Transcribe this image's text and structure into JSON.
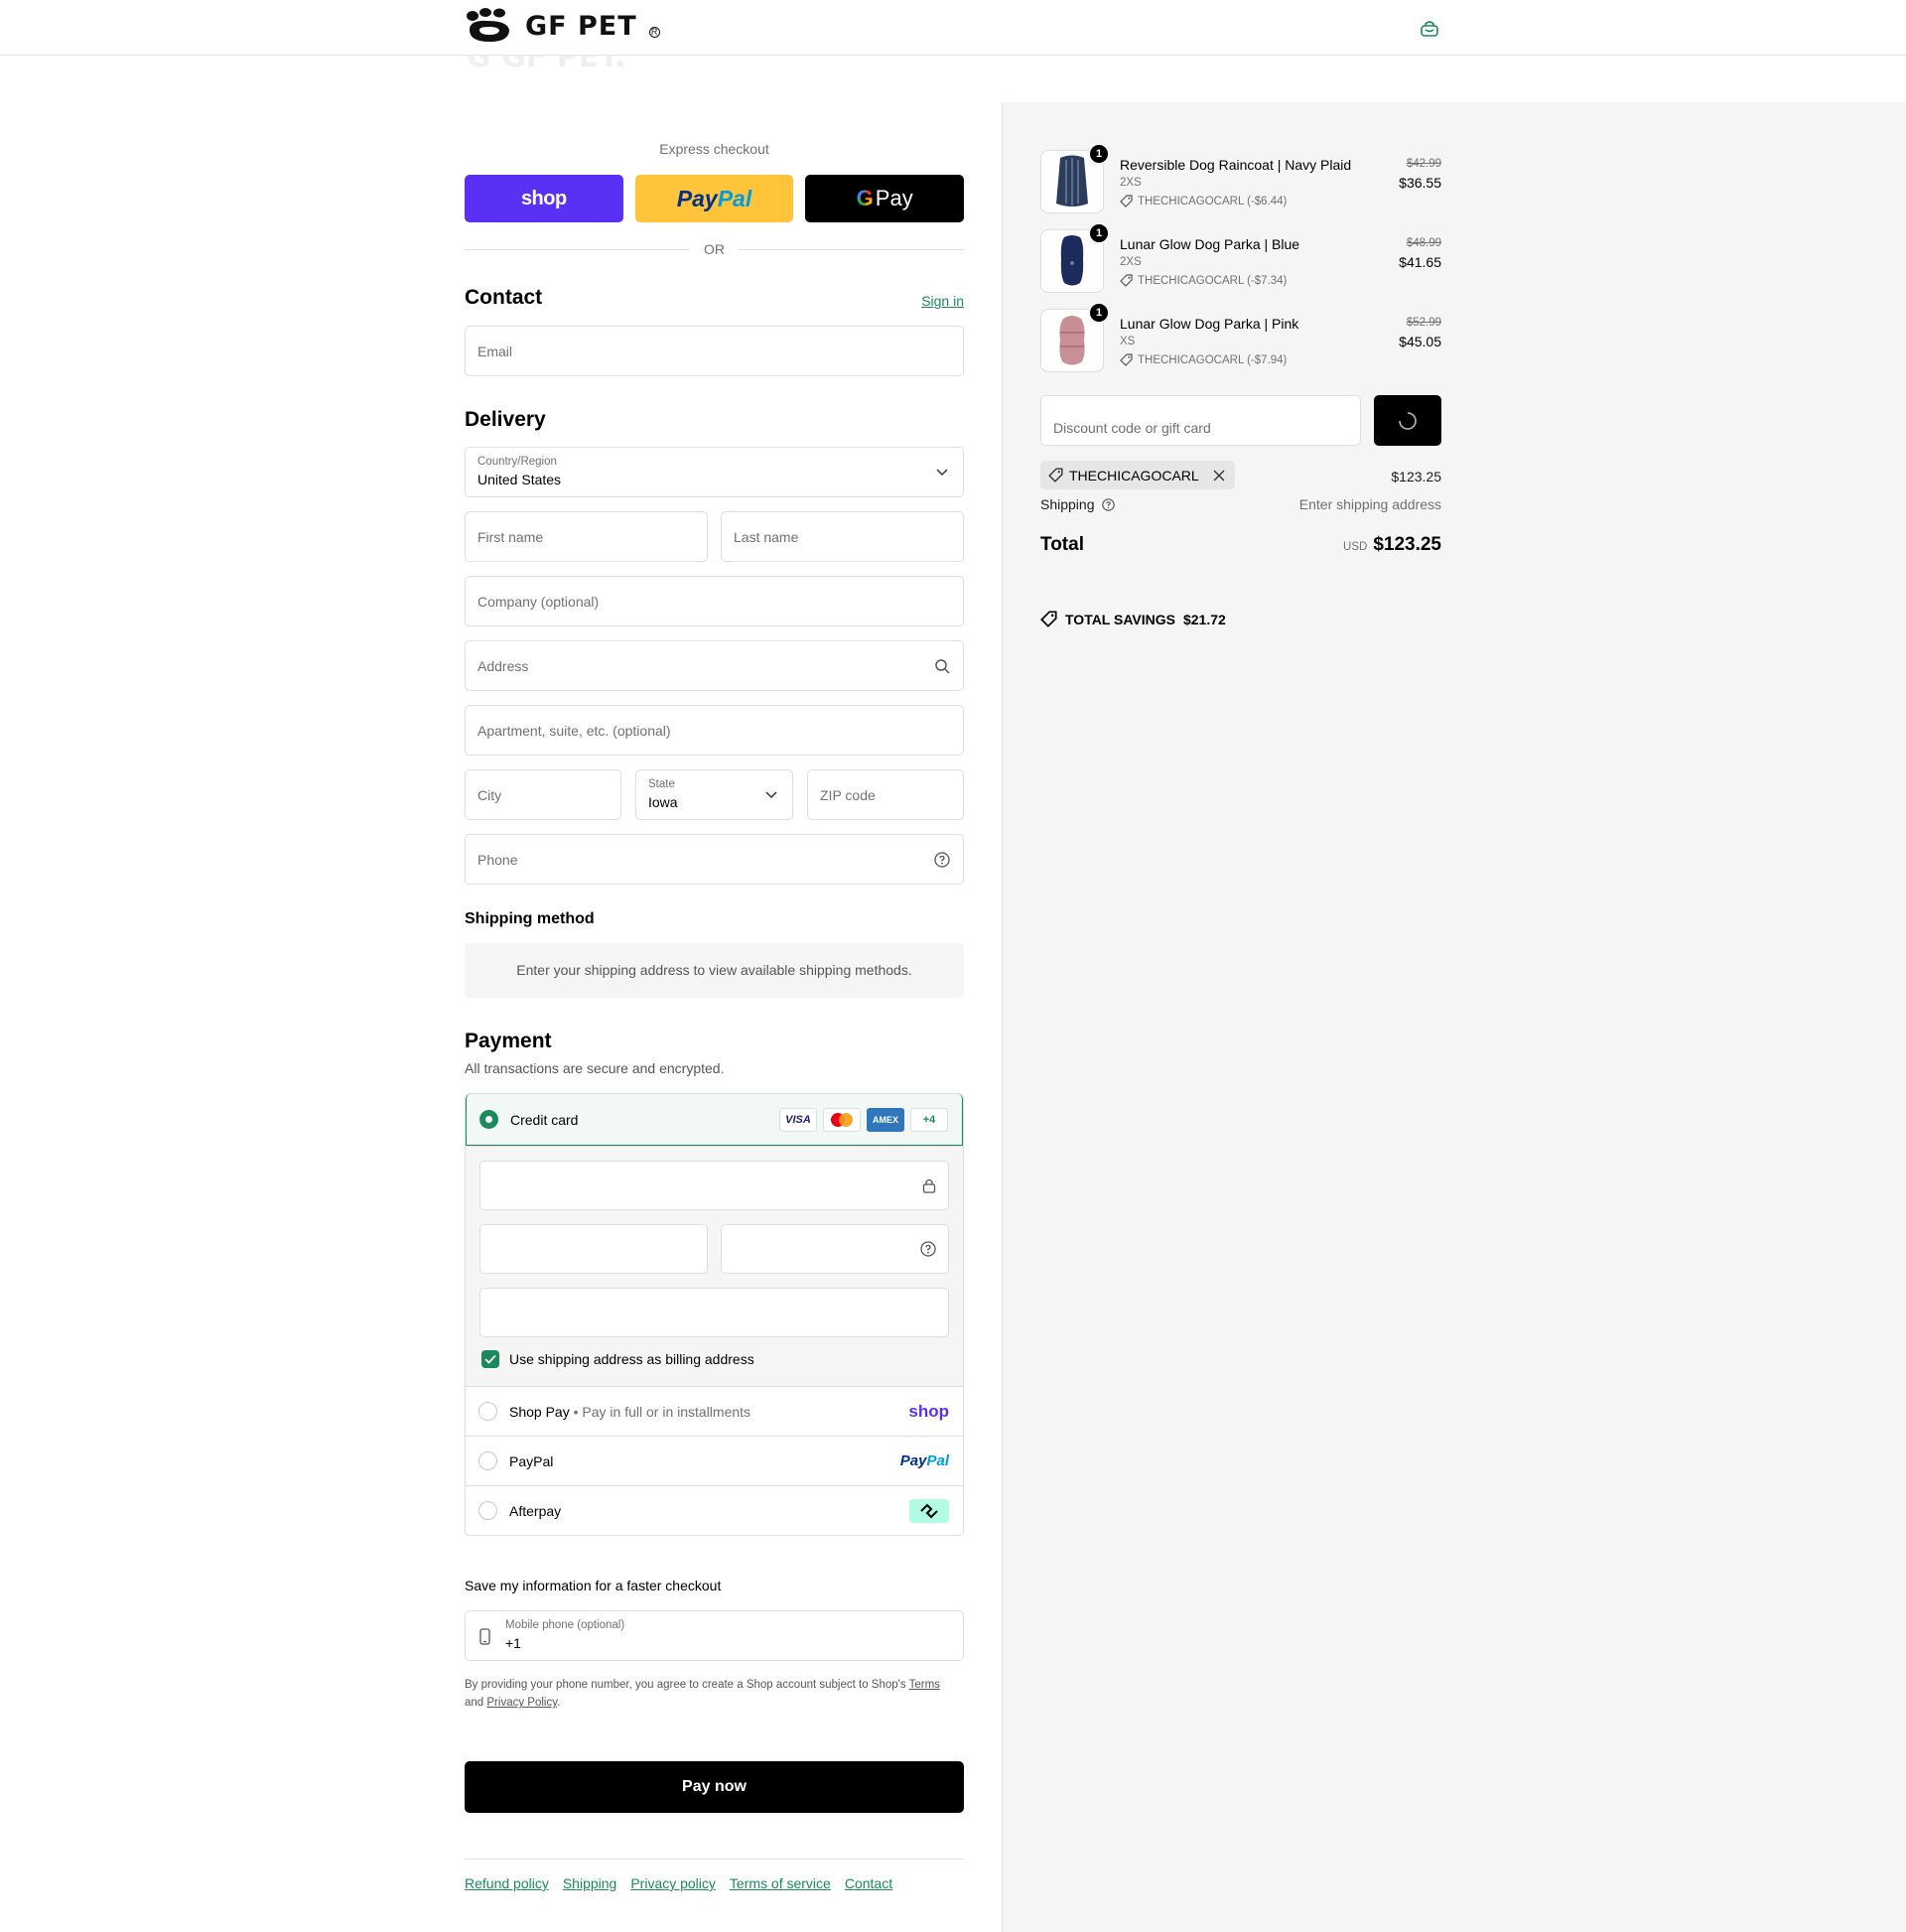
{
  "brand": {
    "name": "GF PET"
  },
  "express": {
    "title": "Express checkout",
    "shop_label": "shop",
    "paypal_a": "Pay",
    "paypal_b": "Pal",
    "gpay_g": "G",
    "gpay_label": "Pay",
    "or": "OR"
  },
  "contact": {
    "title": "Contact",
    "signin": "Sign in",
    "email_placeholder": "Email"
  },
  "delivery": {
    "title": "Delivery",
    "country_label": "Country/Region",
    "country_value": "United States",
    "first_name": "First name",
    "last_name": "Last name",
    "company": "Company (optional)",
    "address": "Address",
    "apartment": "Apartment, suite, etc. (optional)",
    "city": "City",
    "state_label": "State",
    "state_value": "Iowa",
    "zip": "ZIP code",
    "phone": "Phone"
  },
  "shipping_method": {
    "title": "Shipping method",
    "message": "Enter your shipping address to view available shipping methods."
  },
  "payment": {
    "title": "Payment",
    "subtitle": "All transactions are secure and encrypted.",
    "credit_card": "Credit card",
    "card_icons": {
      "visa": "VISA",
      "amex": "AMEX",
      "more": "+4"
    },
    "billing_checkbox": "Use shipping address as billing address",
    "shop_pay": "Shop Pay",
    "shop_pay_sep": "•",
    "shop_pay_desc": "Pay in full or in installments",
    "shop_logo": "shop",
    "paypal": "PayPal",
    "paypal_logo_a": "Pay",
    "paypal_logo_b": "Pal",
    "afterpay": "Afterpay"
  },
  "save_info": {
    "title": "Save my information for a faster checkout",
    "mobile_label": "Mobile phone (optional)",
    "mobile_value": "+1",
    "legal_1": "By providing your phone number, you agree to create a Shop account subject to Shop's",
    "terms": "Terms",
    "legal_and": "and",
    "privacy": "Privacy Policy",
    "legal_end": "."
  },
  "pay_now": "Pay now",
  "footer": [
    "Refund policy",
    "Shipping",
    "Privacy policy",
    "Terms of service",
    "Contact"
  ],
  "cart": {
    "items": [
      {
        "name": "Reversible Dog Raincoat | Navy Plaid",
        "variant": "2XS",
        "qty": "1",
        "discount": "THECHICAGOCARL (-$6.44)",
        "original": "$42.99",
        "price": "$36.55",
        "color": "#2c3c5c"
      },
      {
        "name": "Lunar Glow Dog Parka | Blue",
        "variant": "2XS",
        "qty": "1",
        "discount": "THECHICAGOCARL (-$7.34)",
        "original": "$48.99",
        "price": "$41.65",
        "color": "#1c2a5c"
      },
      {
        "name": "Lunar Glow Dog Parka | Pink",
        "variant": "XS",
        "qty": "1",
        "discount": "THECHICAGOCARL (-$7.94)",
        "original": "$52.99",
        "price": "$45.05",
        "color": "#c98f96"
      }
    ],
    "discount_placeholder": "Discount code or gift card",
    "applied_code": "THECHICAGOCARL",
    "subtotal": "$123.25",
    "shipping_label": "Shipping",
    "shipping_value": "Enter shipping address",
    "total_label": "Total",
    "currency": "USD",
    "total": "$123.25",
    "savings_label": "TOTAL SAVINGS",
    "savings_value": "$21.72"
  },
  "colors": {
    "accent": "#1a8a5a",
    "shop": "#5a31f4",
    "paypal_yellow": "#ffc439"
  }
}
